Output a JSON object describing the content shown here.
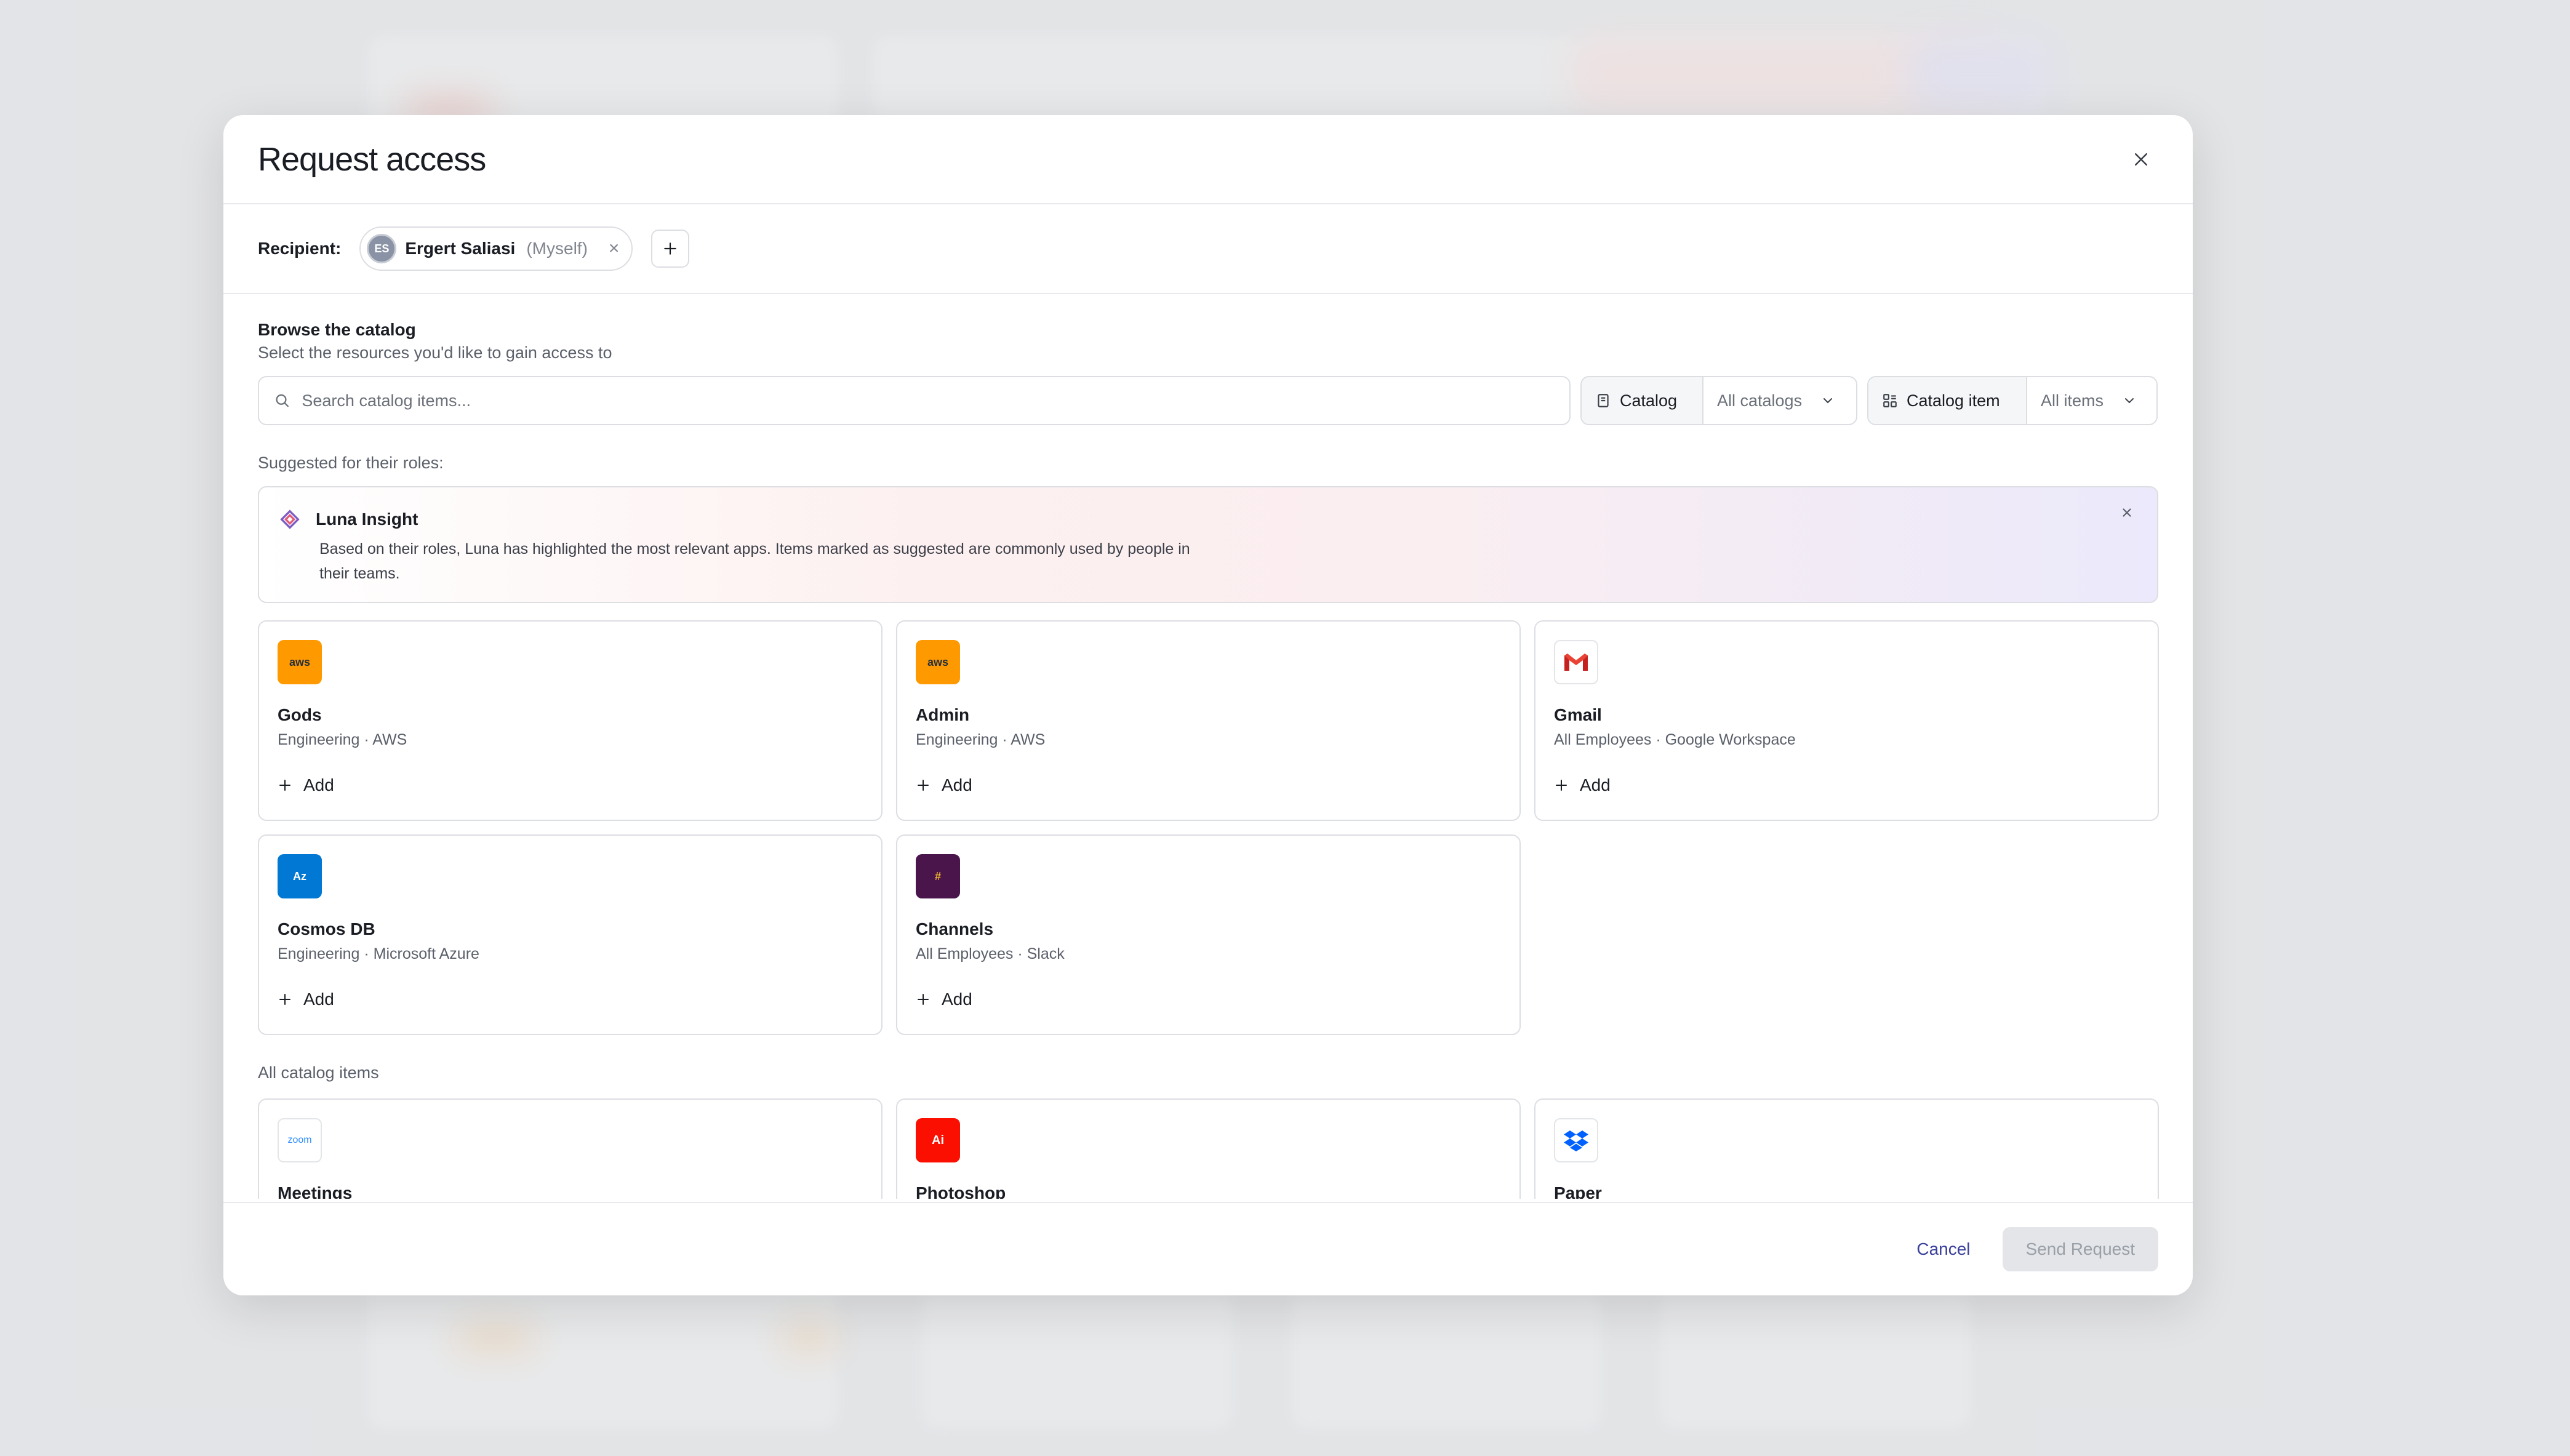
{
  "modal": {
    "title": "Request access"
  },
  "recipient": {
    "label": "Recipient:",
    "initials": "ES",
    "name": "Ergert Saliasi",
    "note": "(Myself)"
  },
  "browse": {
    "title": "Browse the catalog",
    "subtitle": "Select the resources you'd like to gain access to",
    "search_placeholder": "Search catalog items...",
    "filter_catalog_label": "Catalog",
    "filter_catalog_value": "All catalogs",
    "filter_item_label": "Catalog item",
    "filter_item_value": "All items"
  },
  "suggested": {
    "label": "Suggested for their roles:",
    "insight_title": "Luna Insight",
    "insight_text": "Based on their roles, Luna has highlighted the most relevant apps. Items marked as suggested are commonly used by people in their teams.",
    "items": [
      {
        "name": "Gods",
        "meta": "Engineering · AWS",
        "logo": "aws",
        "logo_text": "aws",
        "add": "Add"
      },
      {
        "name": "Admin",
        "meta": "Engineering · AWS",
        "logo": "aws",
        "logo_text": "aws",
        "add": "Add"
      },
      {
        "name": "Gmail",
        "meta": "All Employees · Google Workspace",
        "logo": "gmail",
        "logo_text": "",
        "add": "Add"
      },
      {
        "name": "Cosmos DB",
        "meta": "Engineering · Microsoft Azure",
        "logo": "azure",
        "logo_text": "Az",
        "add": "Add"
      },
      {
        "name": "Channels",
        "meta": "All Employees · Slack",
        "logo": "slack",
        "logo_text": "#",
        "add": "Add"
      }
    ]
  },
  "all_items": {
    "label": "All catalog items",
    "items": [
      {
        "name": "Meetings",
        "logo": "zoom",
        "logo_text": "zoom"
      },
      {
        "name": "Photoshop",
        "logo": "adobe",
        "logo_text": "Ai"
      },
      {
        "name": "Paper",
        "logo": "dropbox",
        "logo_text": ""
      }
    ]
  },
  "footer": {
    "cancel": "Cancel",
    "send": "Send Request"
  },
  "colors": {
    "accent": "#3a3f9a",
    "aws": "#ff9900",
    "azure": "#0078d4",
    "slack": "#4a154b",
    "adobe": "#fa0f00",
    "gmail_red": "#ea4335",
    "dropbox": "#0061ff"
  }
}
